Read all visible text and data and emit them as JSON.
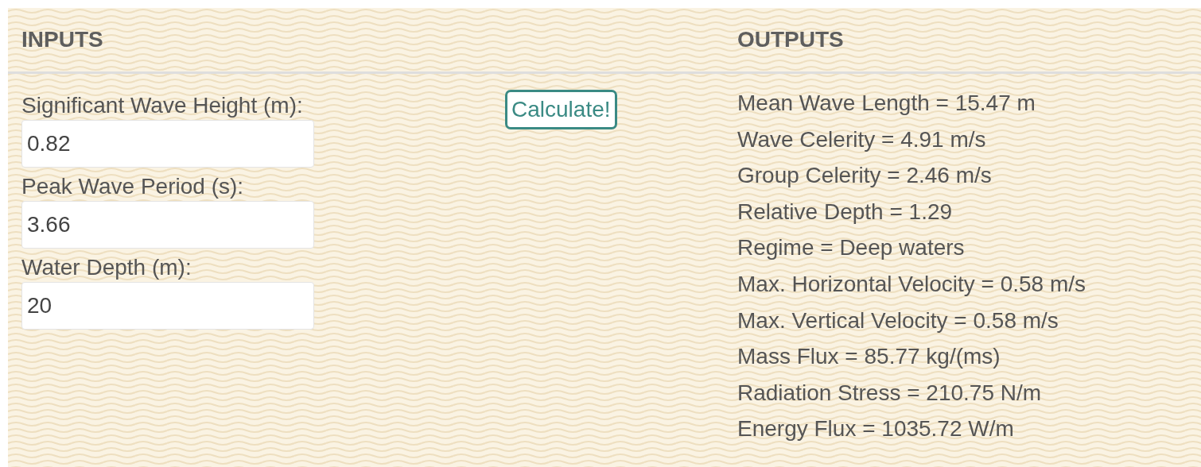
{
  "inputs": {
    "heading": "INPUTS",
    "fields": [
      {
        "label": "Significant Wave Height (m):",
        "value": "0.82"
      },
      {
        "label": "Peak Wave Period (s):",
        "value": "3.66"
      },
      {
        "label": "Water Depth (m):",
        "value": "20"
      }
    ]
  },
  "calculate_button": "Calculate!",
  "outputs": {
    "heading": "OUTPUTS",
    "lines": [
      "Mean Wave Length = 15.47 m",
      "Wave Celerity = 4.91 m/s",
      "Group Celerity = 2.46 m/s",
      "Relative Depth = 1.29",
      "Regime = Deep waters",
      "Max. Horizontal Velocity = 0.58 m/s",
      "Max. Vertical Velocity = 0.58 m/s",
      "Mass Flux = 85.77 kg/(ms)",
      "Radiation Stress = 210.75 N/m",
      "Energy Flux = 1035.72 W/m"
    ]
  }
}
